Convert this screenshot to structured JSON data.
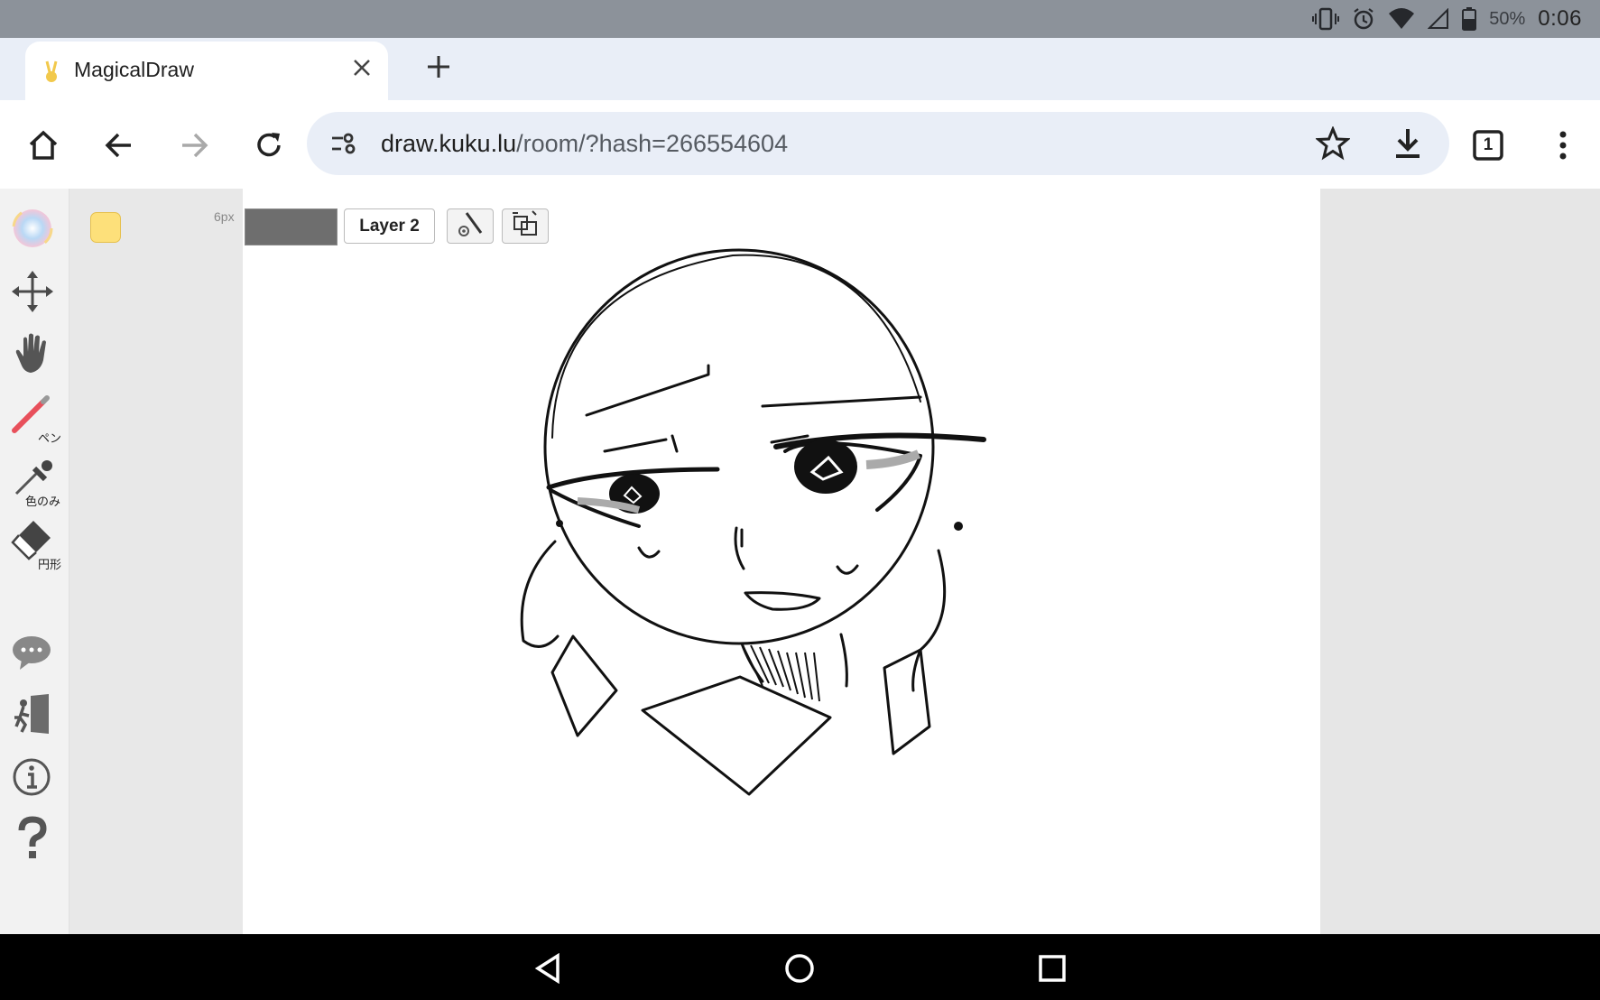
{
  "status_bar": {
    "battery_percent": "50%",
    "time": "0:06",
    "icons": [
      "vibrate-icon",
      "alarm-icon",
      "wifi-icon",
      "signal-icon",
      "battery-icon"
    ]
  },
  "browser": {
    "tab": {
      "title": "MagicalDraw",
      "favicon": "bunny-favicon-icon"
    },
    "new_tab_icon": "plus-icon",
    "url_host": "draw.kuku.lu",
    "url_path": "/room/?hash=266554604",
    "tab_count": "1",
    "toolbar_icons": [
      "home-icon",
      "back-icon",
      "forward-icon",
      "reload-icon",
      "site-settings-icon",
      "star-icon",
      "download-icon",
      "tabs-icon",
      "more-icon"
    ]
  },
  "sidebar": {
    "tools": [
      {
        "name": "color-wheel",
        "label": ""
      },
      {
        "name": "move",
        "label": ""
      },
      {
        "name": "hand",
        "label": ""
      },
      {
        "name": "pen",
        "label": "ペン"
      },
      {
        "name": "eyedropper",
        "label": "色のみ"
      },
      {
        "name": "eraser",
        "label": "円形"
      },
      {
        "name": "chat",
        "label": ""
      },
      {
        "name": "exit",
        "label": ""
      },
      {
        "name": "info",
        "label": ""
      },
      {
        "name": "help",
        "label": ""
      }
    ]
  },
  "canvas_toolbar": {
    "brush_size": "6px",
    "current_color": "#fde07a",
    "layer_color": "#6e6e6e",
    "layer_label": "Layer 2"
  },
  "colors": {
    "status_bar": "#8c929a",
    "tab_strip": "#e9eef7",
    "accent_pen": "#e8505b"
  }
}
